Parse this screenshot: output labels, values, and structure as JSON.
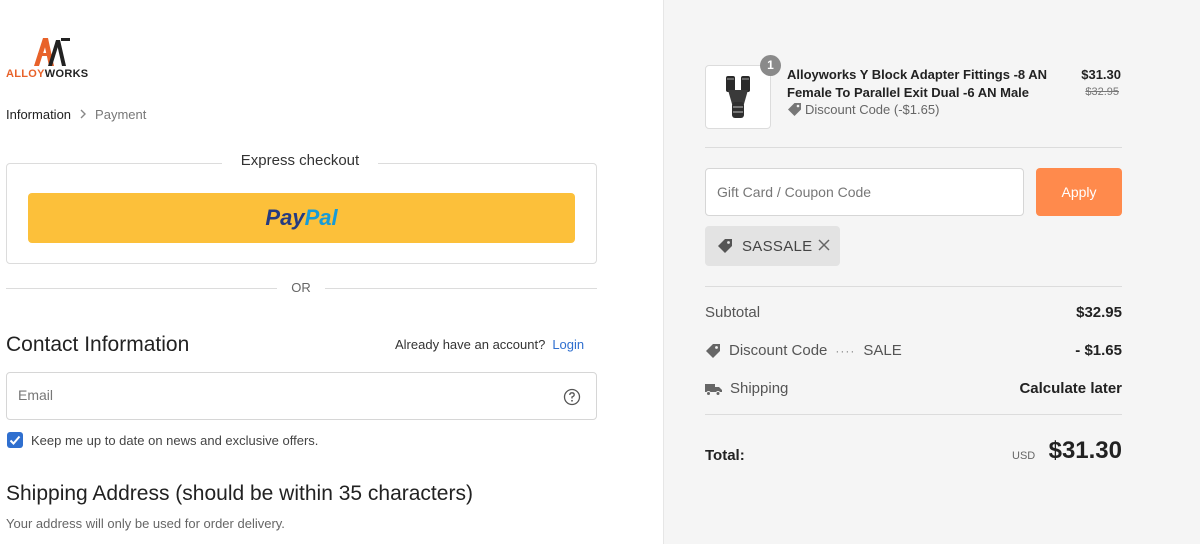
{
  "brand": {
    "name_part1": "ALLOY",
    "name_part2": "WORKS",
    "logo_icon": "aw-logo-icon",
    "accent_color": "#e8622a"
  },
  "breadcrumb": {
    "current": "Information",
    "next": "Payment"
  },
  "express_checkout": {
    "title": "Express checkout",
    "paypal_part1": "Pay",
    "paypal_part2": "Pal",
    "button_color": "#fcc03a"
  },
  "divider": {
    "text": "OR"
  },
  "contact": {
    "title": "Contact Information",
    "account_prompt": "Already have an account?",
    "login_label": "Login",
    "email_placeholder": "Email",
    "newsletter_label": "Keep me up to date on news and exclusive offers.",
    "newsletter_checked": true
  },
  "shipping": {
    "title": "Shipping Address (should be within 35 characters)",
    "subtitle": "Your address will only be used for order delivery."
  },
  "cart": {
    "item": {
      "quantity": "1",
      "name": "Alloyworks Y Block Adapter Fittings -8 AN Female To Parallel Exit Dual -6 AN Male",
      "discount_text": "Discount Code (-$1.65)",
      "price": "$31.30",
      "original_price": "$32.95"
    }
  },
  "coupon": {
    "placeholder": "Gift Card / Coupon Code",
    "apply_label": "Apply",
    "apply_color": "#ff8a4c",
    "applied_code": "SASSALE"
  },
  "summary": {
    "subtotal_label": "Subtotal",
    "subtotal_value": "$32.95",
    "discount_label": "Discount Code",
    "discount_code": "SALE",
    "discount_value": "- $1.65",
    "shipping_label": "Shipping",
    "shipping_value": "Calculate later",
    "total_label": "Total:",
    "total_currency": "USD",
    "total_value": "$31.30"
  }
}
